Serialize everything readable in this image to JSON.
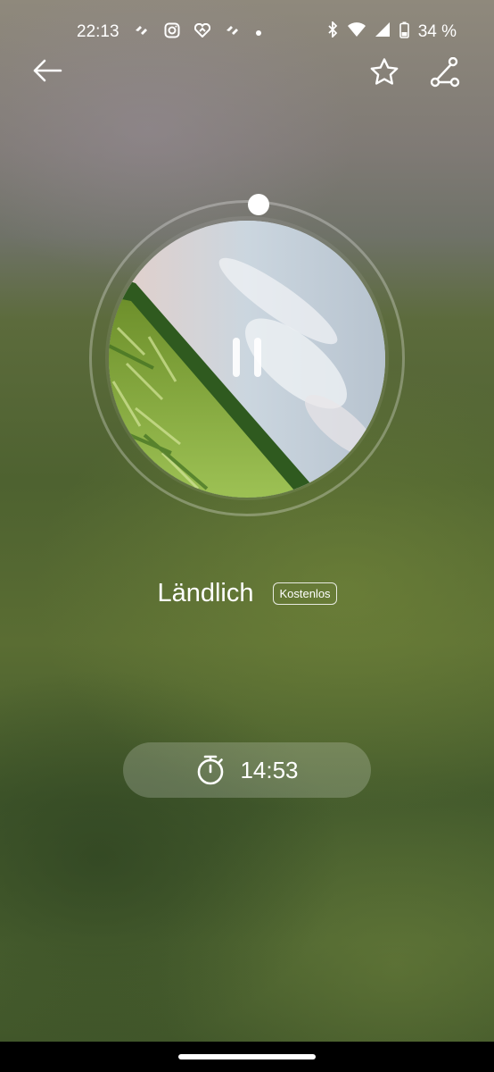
{
  "status_bar": {
    "time": "22:13",
    "notification_icons": [
      "tide-icon",
      "instagram-icon",
      "tide-icon",
      "tide-icon",
      "dot-icon"
    ],
    "system_icons": [
      "bluetooth-icon",
      "wifi-icon",
      "signal-icon",
      "battery-icon"
    ],
    "battery": "34 %"
  },
  "top_bar": {
    "back_icon": "arrow-left-icon",
    "favorite_icon": "star-icon",
    "share_icon": "share-icon"
  },
  "player": {
    "artwork": "cornfield-sky-image",
    "state": "playing",
    "control_icon": "pause-icon"
  },
  "track": {
    "title": "Ländlich",
    "badge": "Kostenlos"
  },
  "timer": {
    "icon": "stopwatch-icon",
    "value": "14:53"
  }
}
